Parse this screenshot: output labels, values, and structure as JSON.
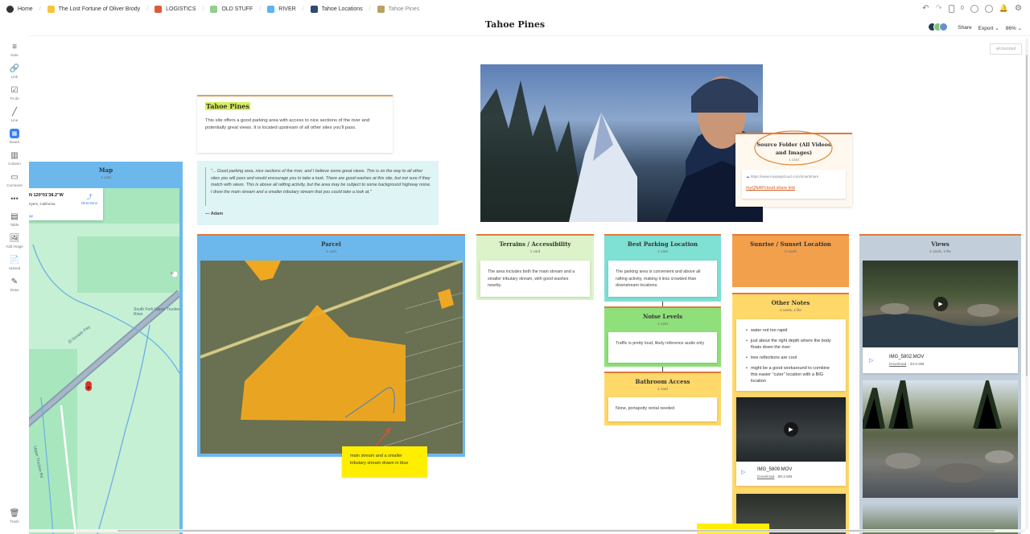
{
  "breadcrumbs": [
    {
      "label": "Home",
      "color": "#333333"
    },
    {
      "label": "The Lost Fortune of Oliver Brody",
      "color": "#f5c542"
    },
    {
      "label": "LOGISTICS",
      "color": "#e05a3a"
    },
    {
      "label": "OLD STUFF",
      "color": "#8fd08a"
    },
    {
      "label": "RIVER",
      "color": "#5bb5f0"
    },
    {
      "label": "Tahoe Locations",
      "color": "#2f4a6e"
    },
    {
      "label": "Tahoe Pines",
      "color": "#b8a060"
    }
  ],
  "header": {
    "title": "Tahoe Pines",
    "share": "Share",
    "export": "Export",
    "zoom": "86%",
    "count": "0"
  },
  "sidebar": [
    "Note",
    "Link",
    "To-do",
    "Line",
    "Board",
    "Column",
    "Comment",
    "Table",
    "Add image",
    "Upload",
    "Draw",
    "Trash"
  ],
  "unsorted": "Unsorted",
  "tahoe_note": {
    "title": "Tahoe Pines",
    "body": "This site offers a good parking area with access to nice sections of the river and potentially great views. It is located upstream of all other sites you'll pass."
  },
  "quote": {
    "text": "\"... Good parking area, nice sections of the river, and I believe some great views.  This is on the way to all other sites you will pass and would encourage you to take a look.  There are good washes at this site, but not sure if they match with views.  This is above all rafting activity, but the area may be subject to some background highway noise.  I drew the main stream and a smaller tributary stream that you could take a look at.\"",
    "author": "— Adam"
  },
  "map": {
    "title": "Map",
    "count": "1 card",
    "coords": "N 120°01'38.2\"W",
    "place": "eyers, California",
    "directions": "Directions",
    "road1": "El Dorado Fwy",
    "road2": "South Fork Upper Truckee River",
    "road3": "Upper Truckee Rd",
    "shield": "50",
    "ap": "ap"
  },
  "parcel": {
    "title": "Parcel",
    "count": "1 card",
    "sticky": "main stream and a smaller tributary stream drawn in blue"
  },
  "source": {
    "title": "Source Folder (All Videos and Images)",
    "count": "1 card",
    "url": "https://www.myqnapcloud.com/smartshare",
    "link": "myQNAPcloud share link"
  },
  "terrains": {
    "title": "Terrains / Accessibility",
    "count": "1 card",
    "body": "The area includes both the main stream and a smaller tributary stream, with good washes nearby."
  },
  "parking": {
    "title": "Best Parking Location",
    "count": "1 card",
    "body": "The parking area is convenient and above all rafting activity, making it less crowded than downstream locations."
  },
  "noise": {
    "title": "Noise Levels",
    "count": "1 card",
    "body": "Traffic is pretty loud, likely reference audio only"
  },
  "bathroom": {
    "title": "Bathroom Access",
    "count": "1 card",
    "body": "None, portapotty rental needed"
  },
  "sunrise": {
    "title": "Sunrise / Sunset Location",
    "count": "0 cards"
  },
  "other": {
    "title": "Other Notes",
    "count": "3 cards, 1 file",
    "bullets": [
      "water not too rapid",
      "just about the right depth where the body floats down the river",
      "tree reflections are cool",
      "might be a good workaround to combine this easier \"cuter\" location with a BIG location"
    ],
    "video": "IMG_5809.MOV",
    "download": "Download",
    "size": "89.3 MB"
  },
  "views": {
    "title": "Views",
    "count": "2 cards, 1 file",
    "video": "IMG_5802.MOV",
    "download": "Download",
    "size": "33.5 MB"
  }
}
